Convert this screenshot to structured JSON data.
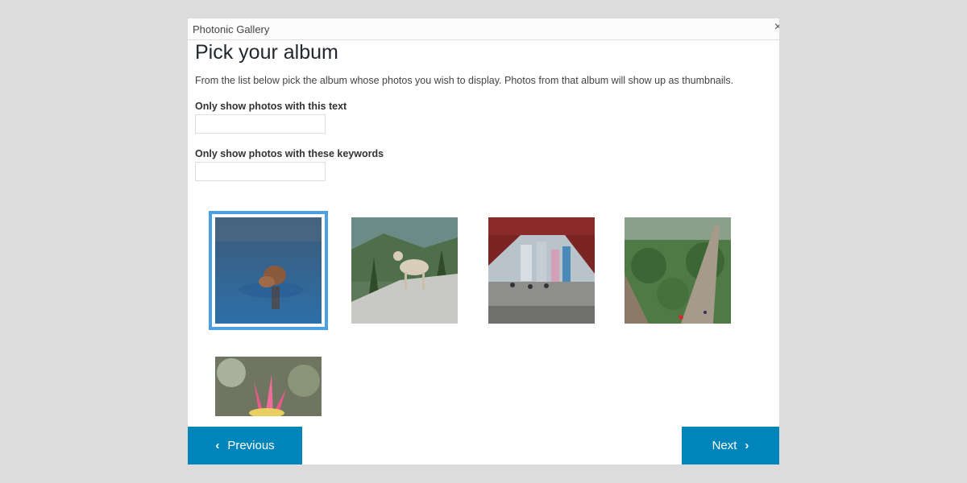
{
  "window": {
    "title": "Photonic Gallery",
    "close_icon": "close-icon"
  },
  "page": {
    "heading": "Pick your album",
    "description": "From the list below pick the album whose photos you wish to display. Photos from that album will show up as thumbnails."
  },
  "filters": {
    "text_label": "Only show photos with this text",
    "text_value": "",
    "keywords_label": "Only show photos with these keywords",
    "keywords_value": ""
  },
  "albums": [
    {
      "subject": "animal-in-water",
      "selected": true
    },
    {
      "subject": "mountain-goat",
      "selected": false
    },
    {
      "subject": "city-street",
      "selected": false
    },
    {
      "subject": "great-wall",
      "selected": false
    },
    {
      "subject": "pink-flower",
      "selected": false
    }
  ],
  "navigation": {
    "previous_label": "Previous",
    "next_label": "Next"
  },
  "colors": {
    "accent": "#0085ba",
    "selection": "#4aa0e3"
  }
}
